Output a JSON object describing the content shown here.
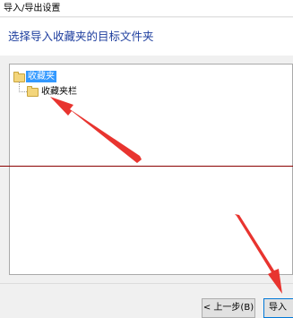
{
  "window": {
    "title": "导入/导出设置"
  },
  "header": {
    "instruction": "选择导入收藏夹的目标文件夹"
  },
  "tree": {
    "root": {
      "label": "收藏夹",
      "selected": true,
      "icon": "folder-icon"
    },
    "children": [
      {
        "label": "收藏夹栏",
        "icon": "folder-icon"
      }
    ]
  },
  "buttons": {
    "back": "< 上一步(B)",
    "import": "导入"
  },
  "colors": {
    "selection": "#3399ff",
    "header_text": "#1f3f9f",
    "annotation_arrow": "#e8342f",
    "divider_line": "#8b0000"
  }
}
